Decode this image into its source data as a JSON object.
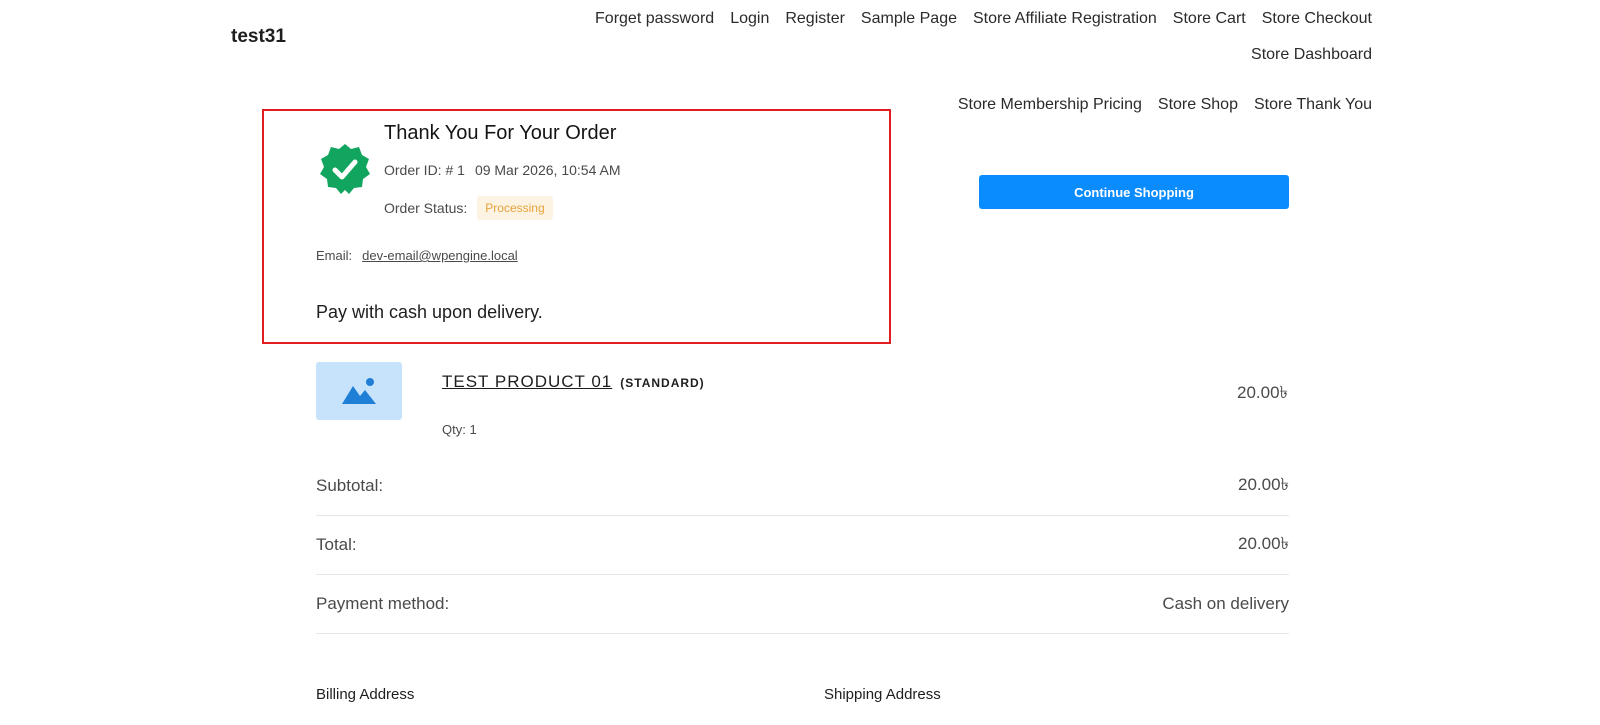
{
  "site": {
    "title": "test31"
  },
  "nav": {
    "row1": [
      "Forget password",
      "Login",
      "Register",
      "Sample Page",
      "Store Affiliate Registration",
      "Store Cart",
      "Store Checkout",
      "Store Dashboard"
    ],
    "row2": [
      "Store Membership Pricing",
      "Store Shop",
      "Store Thank You"
    ]
  },
  "order": {
    "title": "Thank You For Your Order",
    "id_label": "Order ID:",
    "id_value": "# 1",
    "date": "09 Mar 2026, 10:54 AM",
    "status_label": "Order Status:",
    "status_value": "Processing",
    "email_label": "Email:",
    "email_value": "dev-email@wpengine.local",
    "payment_note": "Pay with cash upon delivery."
  },
  "actions": {
    "continue_label": "Continue Shopping"
  },
  "product": {
    "name": "TEST PRODUCT 01",
    "variant": "(STANDARD)",
    "qty": "Qty: 1",
    "price": "20.00৳"
  },
  "summary": [
    {
      "label": "Subtotal:",
      "value": "20.00৳"
    },
    {
      "label": "Total:",
      "value": "20.00৳"
    },
    {
      "label": "Payment method:",
      "value": "Cash on delivery"
    }
  ],
  "addresses": {
    "billing_label": "Billing Address",
    "shipping_label": "Shipping Address"
  },
  "colors": {
    "accent": "#0a8cff",
    "success": "#12a55f",
    "status_bg": "#fdf3e3",
    "status_text": "#e8a23a",
    "highlight": "#e01e1e"
  }
}
